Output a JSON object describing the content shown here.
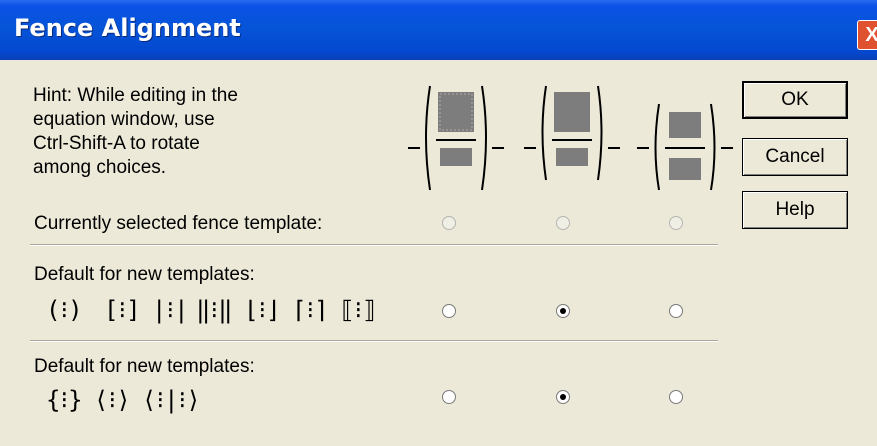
{
  "dialog": {
    "title": "Fence Alignment",
    "close_glyph": "X"
  },
  "hint": "Hint: While editing in the\nequation window, use\nCtrl-Shift-A to rotate\namong choices.",
  "rows": {
    "current": {
      "label": "Currently selected fence template:",
      "selected": null
    },
    "default1": {
      "label": "Default for new templates:",
      "selected": 2
    },
    "default2": {
      "label": "Default for new templates:",
      "selected": 2
    }
  },
  "buttons": {
    "ok": "OK",
    "cancel": "Cancel",
    "help": "Help"
  },
  "icons": {
    "close": "close-icon",
    "fence_options": [
      "fence-align-stretch-icon",
      "fence-align-center-icon",
      "fence-align-math-icon"
    ],
    "row2_templates": [
      "paren-template-icon",
      "bracket-template-icon",
      "bar-template-icon",
      "double-bar-template-icon",
      "floor-template-icon",
      "ceiling-template-icon",
      "double-bracket-template-icon"
    ],
    "row3_templates": [
      "brace-template-icon",
      "angle-template-icon",
      "angle-bar-template-icon"
    ]
  },
  "colors": {
    "titlebar": "#0654d8",
    "dialog_bg": "#ece9d8",
    "close": "#e0512f"
  }
}
